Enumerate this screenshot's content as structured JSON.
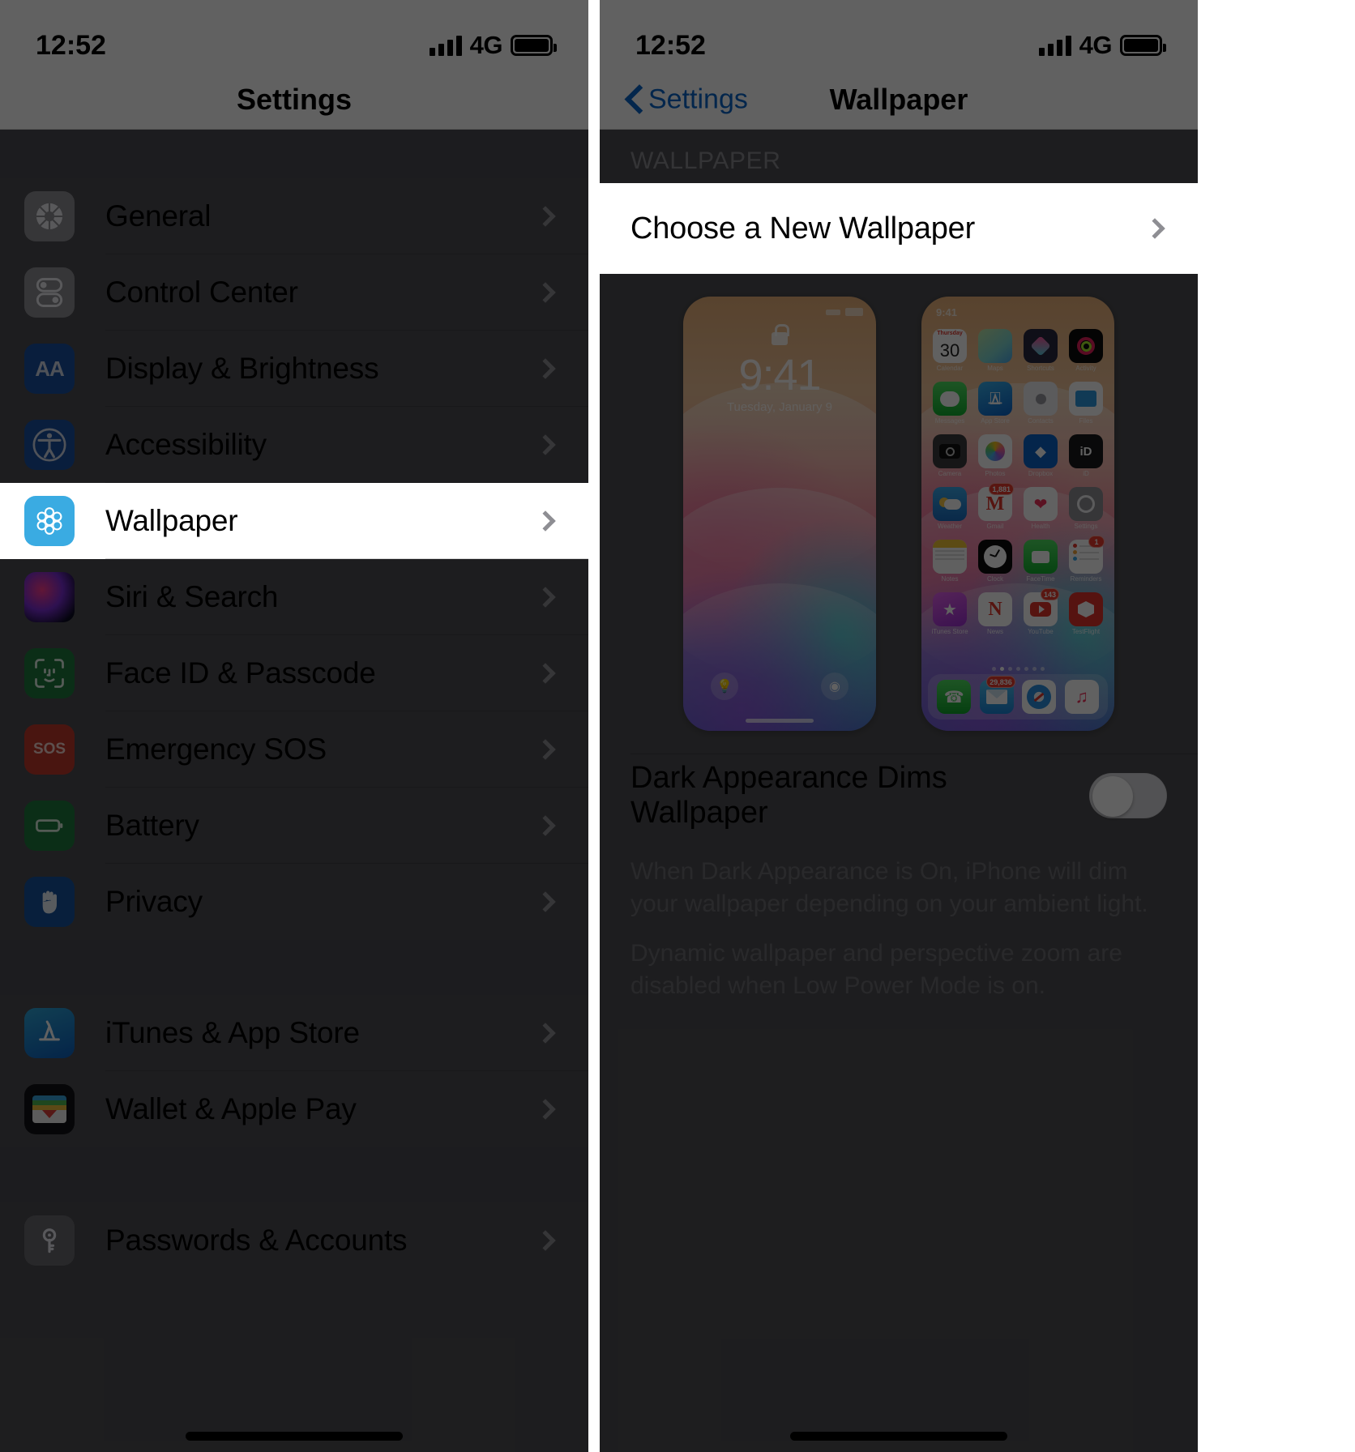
{
  "left_screen": {
    "status_bar": {
      "time": "12:52",
      "network": "4G",
      "signal_icon": "signal-bars-icon",
      "battery_icon": "battery-icon"
    },
    "nav": {
      "title": "Settings"
    },
    "groups": [
      {
        "items": [
          {
            "label": "General",
            "icon": "gear-icon",
            "icon_color": "#8e8e93",
            "chevron": "chevron-right-icon",
            "highlighted": false
          },
          {
            "label": "Control Center",
            "icon": "sliders-icon",
            "icon_color": "#8e8e93",
            "chevron": "chevron-right-icon",
            "highlighted": false
          },
          {
            "label": "Display & Brightness",
            "icon": "aa-icon",
            "icon_color": "#1a4fa0",
            "chevron": "chevron-right-icon",
            "highlighted": false
          },
          {
            "label": "Accessibility",
            "icon": "accessibility-icon",
            "icon_color": "#1a4fa0",
            "chevron": "chevron-right-icon",
            "highlighted": false
          },
          {
            "label": "Wallpaper",
            "icon": "wallpaper-flower-icon",
            "icon_color": "#3aabe2",
            "chevron": "chevron-right-icon",
            "highlighted": true
          },
          {
            "label": "Siri & Search",
            "icon": "siri-icon",
            "icon_color": "#2b2b35",
            "chevron": "chevron-right-icon",
            "highlighted": false
          },
          {
            "label": "Face ID & Passcode",
            "icon": "face-id-icon",
            "icon_color": "#1f7a3e",
            "chevron": "chevron-right-icon",
            "highlighted": false
          },
          {
            "label": "Emergency SOS",
            "icon": "sos-icon",
            "icon_color": "#c0392b",
            "chevron": "chevron-right-icon",
            "highlighted": false
          },
          {
            "label": "Battery",
            "icon": "battery-icon",
            "icon_color": "#1f7a3e",
            "chevron": "chevron-right-icon",
            "highlighted": false
          },
          {
            "label": "Privacy",
            "icon": "hand-icon",
            "icon_color": "#15539e",
            "chevron": "chevron-right-icon",
            "highlighted": false
          }
        ]
      },
      {
        "items": [
          {
            "label": "iTunes & App Store",
            "icon": "app-store-icon",
            "icon_color": "#1a7ec8",
            "chevron": "chevron-right-icon",
            "highlighted": false
          },
          {
            "label": "Wallet & Apple Pay",
            "icon": "wallet-icon",
            "icon_color": "#111115",
            "chevron": "chevron-right-icon",
            "highlighted": false
          }
        ]
      },
      {
        "items": [
          {
            "label": "Passwords & Accounts",
            "icon": "key-icon",
            "icon_color": "#6a6a70",
            "chevron": "chevron-right-icon",
            "highlighted": false
          }
        ]
      }
    ]
  },
  "right_screen": {
    "status_bar": {
      "time": "12:52",
      "network": "4G",
      "signal_icon": "signal-bars-icon",
      "battery_icon": "battery-icon"
    },
    "nav": {
      "back_label": "Settings",
      "back_icon": "chevron-left-icon",
      "title": "Wallpaper"
    },
    "group_header": "WALLPAPER",
    "choose_row": {
      "label": "Choose a New Wallpaper",
      "chevron": "chevron-right-icon",
      "highlighted": true
    },
    "preview": {
      "lock_screen": {
        "time": "9:41",
        "date": "Tuesday, January 9",
        "lock_icon": "lock-icon",
        "flashlight_icon": "flashlight-icon",
        "camera_icon": "camera-icon"
      },
      "home_screen": {
        "time": "9:41",
        "apps": [
          {
            "name": "Calendar",
            "icon": "calendar-icon",
            "bg": "#ffffff",
            "glyph": "30",
            "badge": ""
          },
          {
            "name": "Maps",
            "icon": "maps-icon",
            "bg": "#e8f3e2",
            "glyph": "",
            "badge": ""
          },
          {
            "name": "Shortcuts",
            "icon": "shortcuts-icon",
            "bg": "#2c2c45",
            "glyph": "",
            "badge": ""
          },
          {
            "name": "Activity",
            "icon": "activity-icon",
            "bg": "#111111",
            "glyph": "",
            "badge": ""
          },
          {
            "name": "Messages",
            "icon": "messages-icon",
            "bg": "#1db340",
            "glyph": "",
            "badge": ""
          },
          {
            "name": "App Store",
            "icon": "app-store-icon",
            "bg": "#1a86e0",
            "glyph": "",
            "badge": ""
          },
          {
            "name": "Contacts",
            "icon": "contacts-icon",
            "bg": "#e9e9ec",
            "glyph": "",
            "badge": ""
          },
          {
            "name": "Files",
            "icon": "files-icon",
            "bg": "#3ba7e8",
            "glyph": "",
            "badge": ""
          },
          {
            "name": "Camera",
            "icon": "camera-icon",
            "bg": "#3a3a3c",
            "glyph": "",
            "badge": ""
          },
          {
            "name": "Photos",
            "icon": "photos-icon",
            "bg": "#ffffff",
            "glyph": "",
            "badge": ""
          },
          {
            "name": "Dropbox",
            "icon": "dropbox-icon",
            "bg": "#0a5fc4",
            "glyph": "",
            "badge": ""
          },
          {
            "name": "iD",
            "icon": "id-app-icon",
            "bg": "#1a1a1c",
            "glyph": "iD",
            "badge": ""
          },
          {
            "name": "Weather",
            "icon": "weather-icon",
            "bg": "#1a8fe0",
            "glyph": "",
            "badge": ""
          },
          {
            "name": "Gmail",
            "icon": "gmail-icon",
            "bg": "#ffffff",
            "glyph": "M",
            "badge": "1,881"
          },
          {
            "name": "Health",
            "icon": "health-icon",
            "bg": "#ffffff",
            "glyph": "",
            "badge": ""
          },
          {
            "name": "Settings",
            "icon": "settings-gear-icon",
            "bg": "#8e8e93",
            "glyph": "",
            "badge": ""
          },
          {
            "name": "Notes",
            "icon": "notes-icon",
            "bg": "#ffffff",
            "glyph": "",
            "badge": ""
          },
          {
            "name": "Clock",
            "icon": "clock-icon",
            "bg": "#111111",
            "glyph": "",
            "badge": ""
          },
          {
            "name": "FaceTime",
            "icon": "facetime-icon",
            "bg": "#1db340",
            "glyph": "",
            "badge": ""
          },
          {
            "name": "Reminders",
            "icon": "reminders-icon",
            "bg": "#ffffff",
            "glyph": "",
            "badge": "1"
          },
          {
            "name": "iTunes Store",
            "icon": "itunes-store-icon",
            "bg": "#b52fd0",
            "glyph": "",
            "badge": ""
          },
          {
            "name": "News",
            "icon": "news-icon",
            "bg": "#ffffff",
            "glyph": "N",
            "badge": ""
          },
          {
            "name": "YouTube",
            "icon": "youtube-icon",
            "bg": "#ffffff",
            "glyph": "",
            "badge": "143"
          },
          {
            "name": "TestFlight",
            "icon": "testflight-icon",
            "bg": "#e2342c",
            "glyph": "",
            "badge": ""
          }
        ],
        "page_dots": 7,
        "active_dot": 1,
        "dock": [
          {
            "name": "Phone",
            "icon": "phone-icon",
            "bg": "#1db340",
            "badge": ""
          },
          {
            "name": "Mail",
            "icon": "mail-icon",
            "bg": "#2a9de0",
            "badge": "29,836"
          },
          {
            "name": "Safari",
            "icon": "safari-icon",
            "bg": "#ffffff",
            "badge": ""
          },
          {
            "name": "Music",
            "icon": "music-icon",
            "bg": "#ffffff",
            "badge": ""
          }
        ]
      }
    },
    "toggle": {
      "label": "Dark Appearance Dims Wallpaper",
      "state": "off",
      "track_color": "#d8d8dc"
    },
    "footer": [
      "When Dark Appearance is On, iPhone will dim your wallpaper depending on your ambient light.",
      "Dynamic wallpaper and perspective zoom are disabled when Low Power Mode is on."
    ]
  }
}
